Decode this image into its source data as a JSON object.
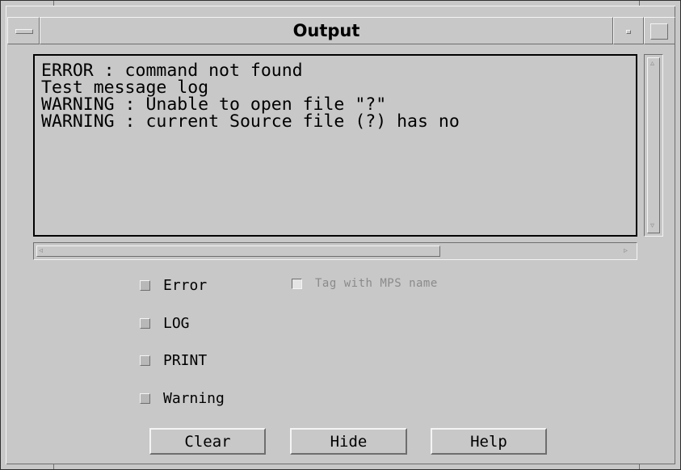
{
  "window": {
    "title": "Output"
  },
  "output": {
    "lines": [
      "ERROR : command not found",
      "Test message log",
      "WARNING : Unable to open file \"?\"",
      "WARNING : current Source file (?) has no"
    ]
  },
  "filters": {
    "error": "Error",
    "log": "LOG",
    "print": "PRINT",
    "warning": "Warning",
    "tag_with_mps_name": "Tag with MPS name"
  },
  "buttons": {
    "clear": "Clear",
    "hide": "Hide",
    "help": "Help"
  },
  "icons": {
    "window_menu": "window-menu-icon",
    "minimize": "minimize-icon",
    "maximize": "maximize-icon",
    "scroll_up": "arrow-up-icon",
    "scroll_down": "arrow-down-icon",
    "scroll_left": "arrow-left-icon",
    "scroll_right": "arrow-right-icon"
  }
}
